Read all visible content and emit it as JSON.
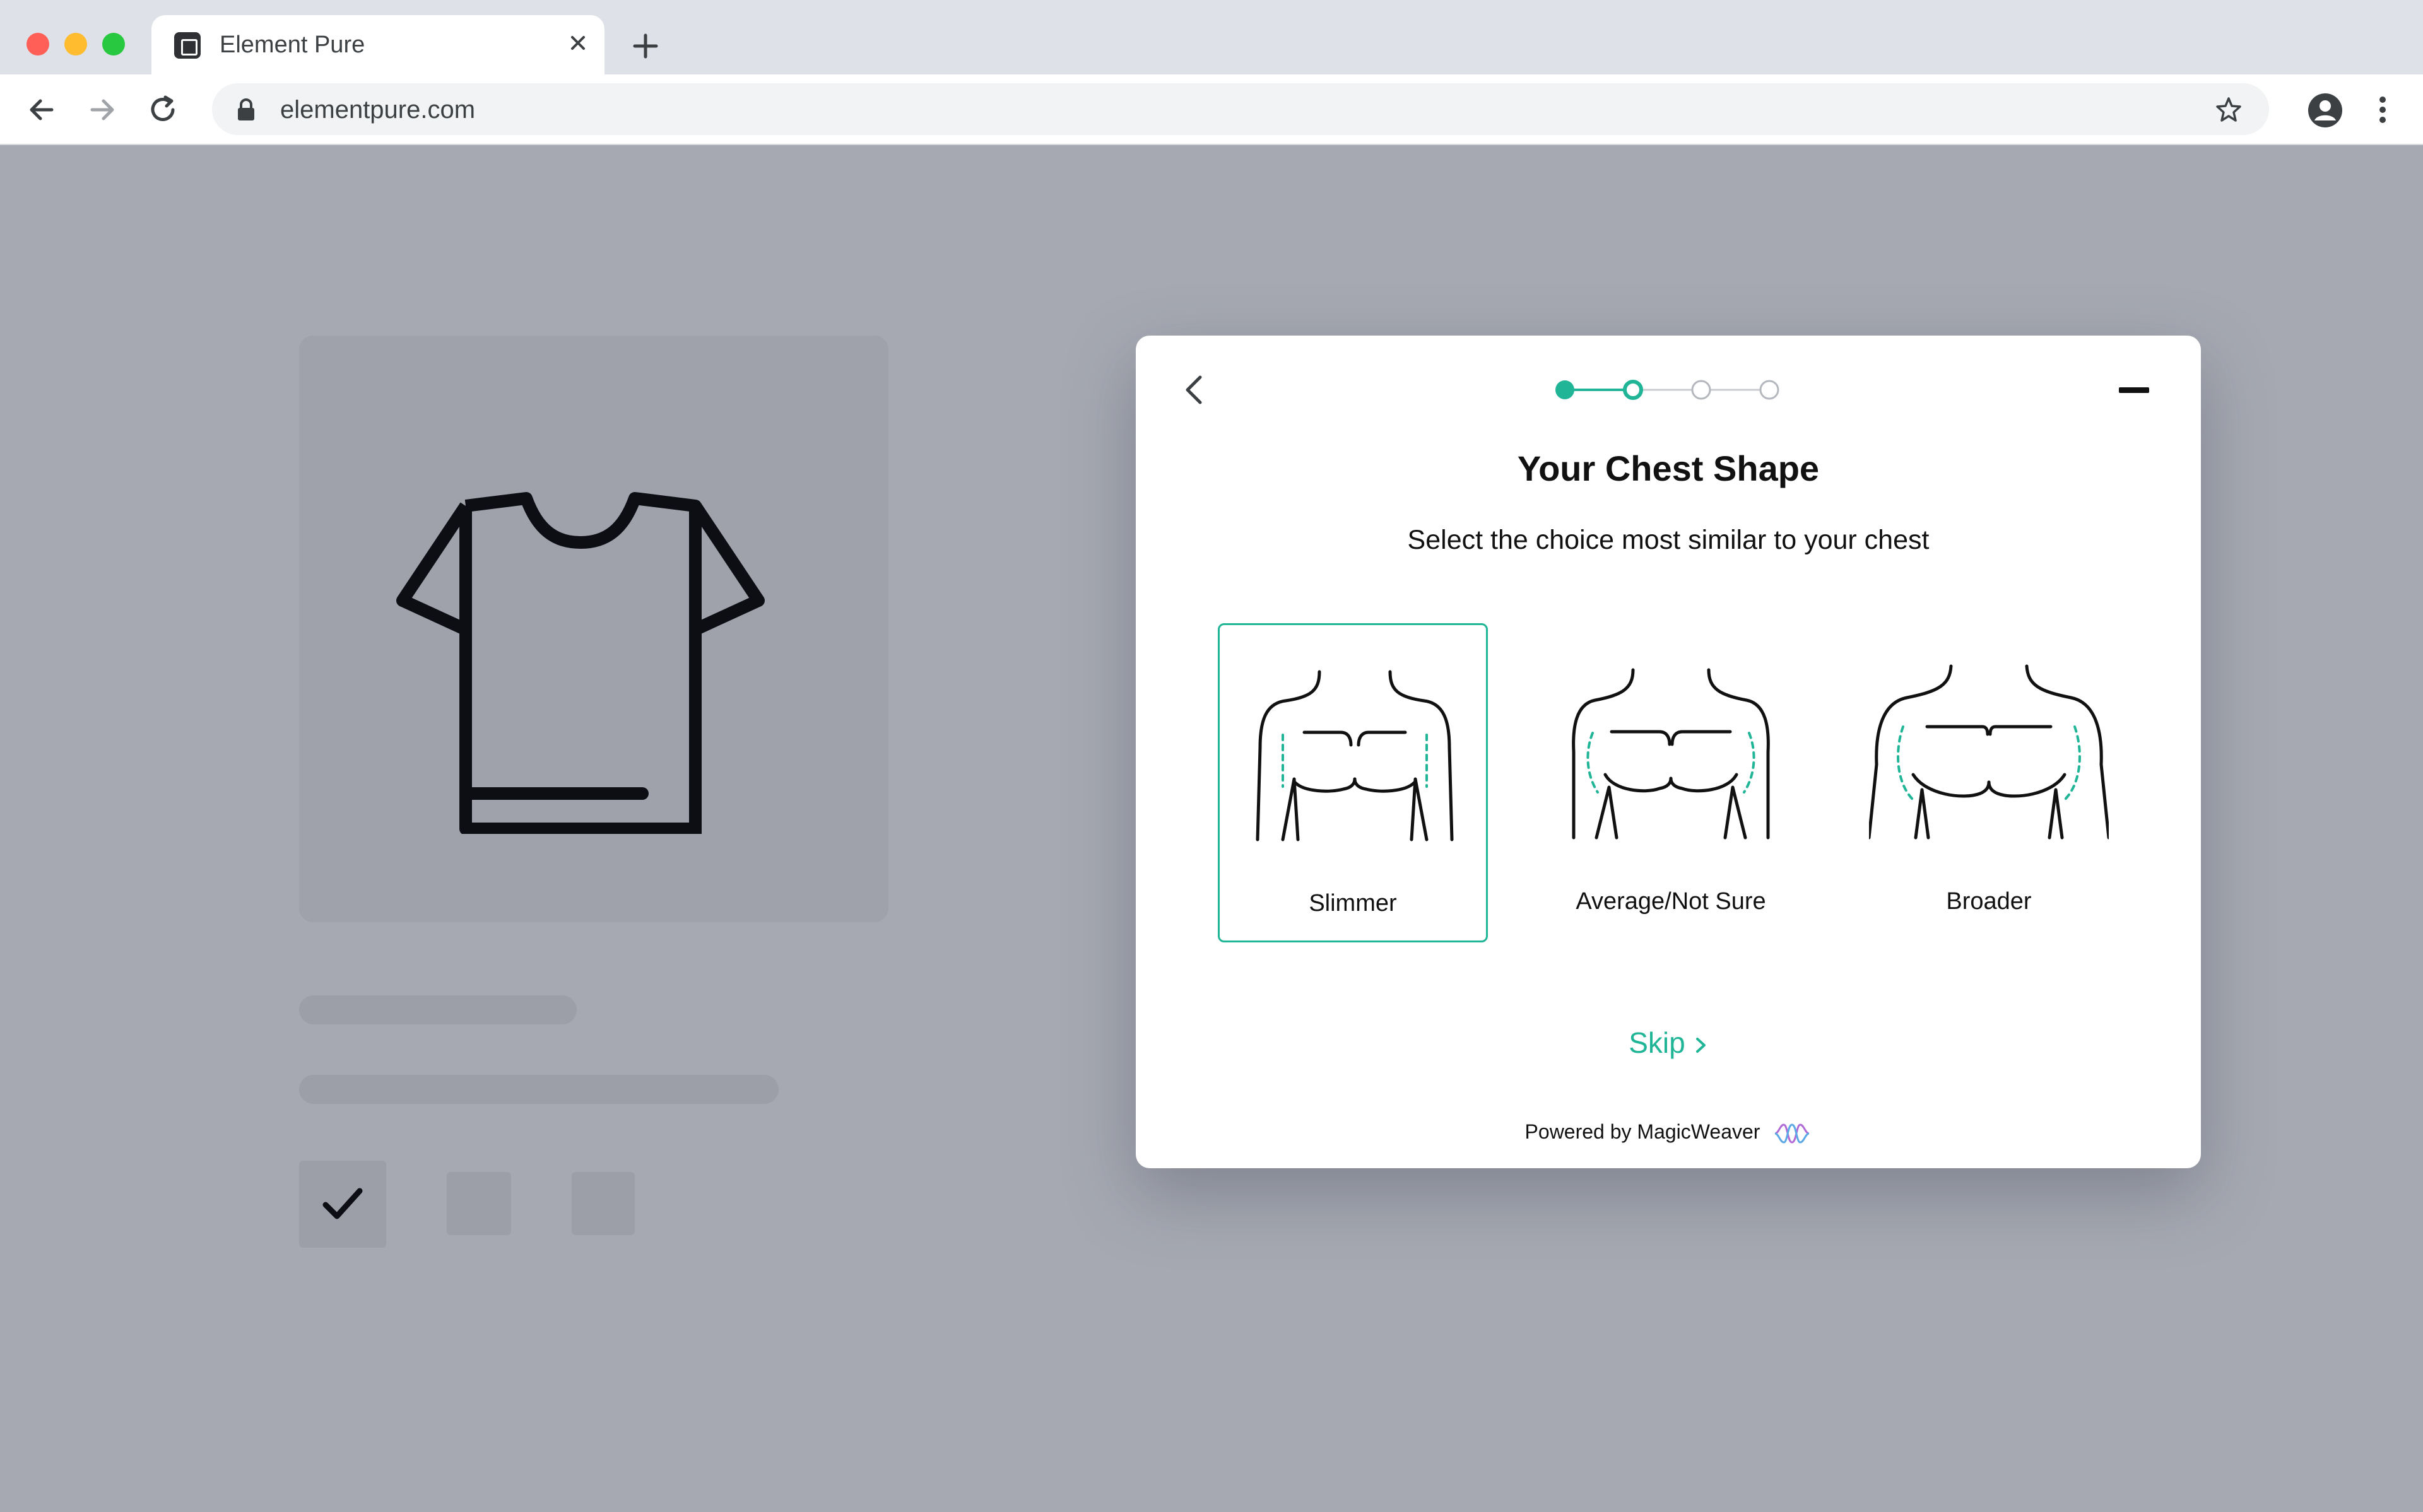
{
  "browser": {
    "tab_title": "Element Pure",
    "url": "elementpure.com"
  },
  "modal": {
    "title": "Your Chest Shape",
    "subtitle": "Select the choice most similar to your chest",
    "steps_total": 4,
    "current_step": 2,
    "options": [
      {
        "label": "Slimmer",
        "selected": true
      },
      {
        "label": "Average/Not Sure",
        "selected": false
      },
      {
        "label": "Broader",
        "selected": false
      }
    ],
    "skip_label": "Skip",
    "powered_by": "Powered by MagicWeaver"
  },
  "colors": {
    "accent": "#20b597",
    "page_background": "#a6a9b2",
    "placeholder": "#9fa1ab"
  }
}
